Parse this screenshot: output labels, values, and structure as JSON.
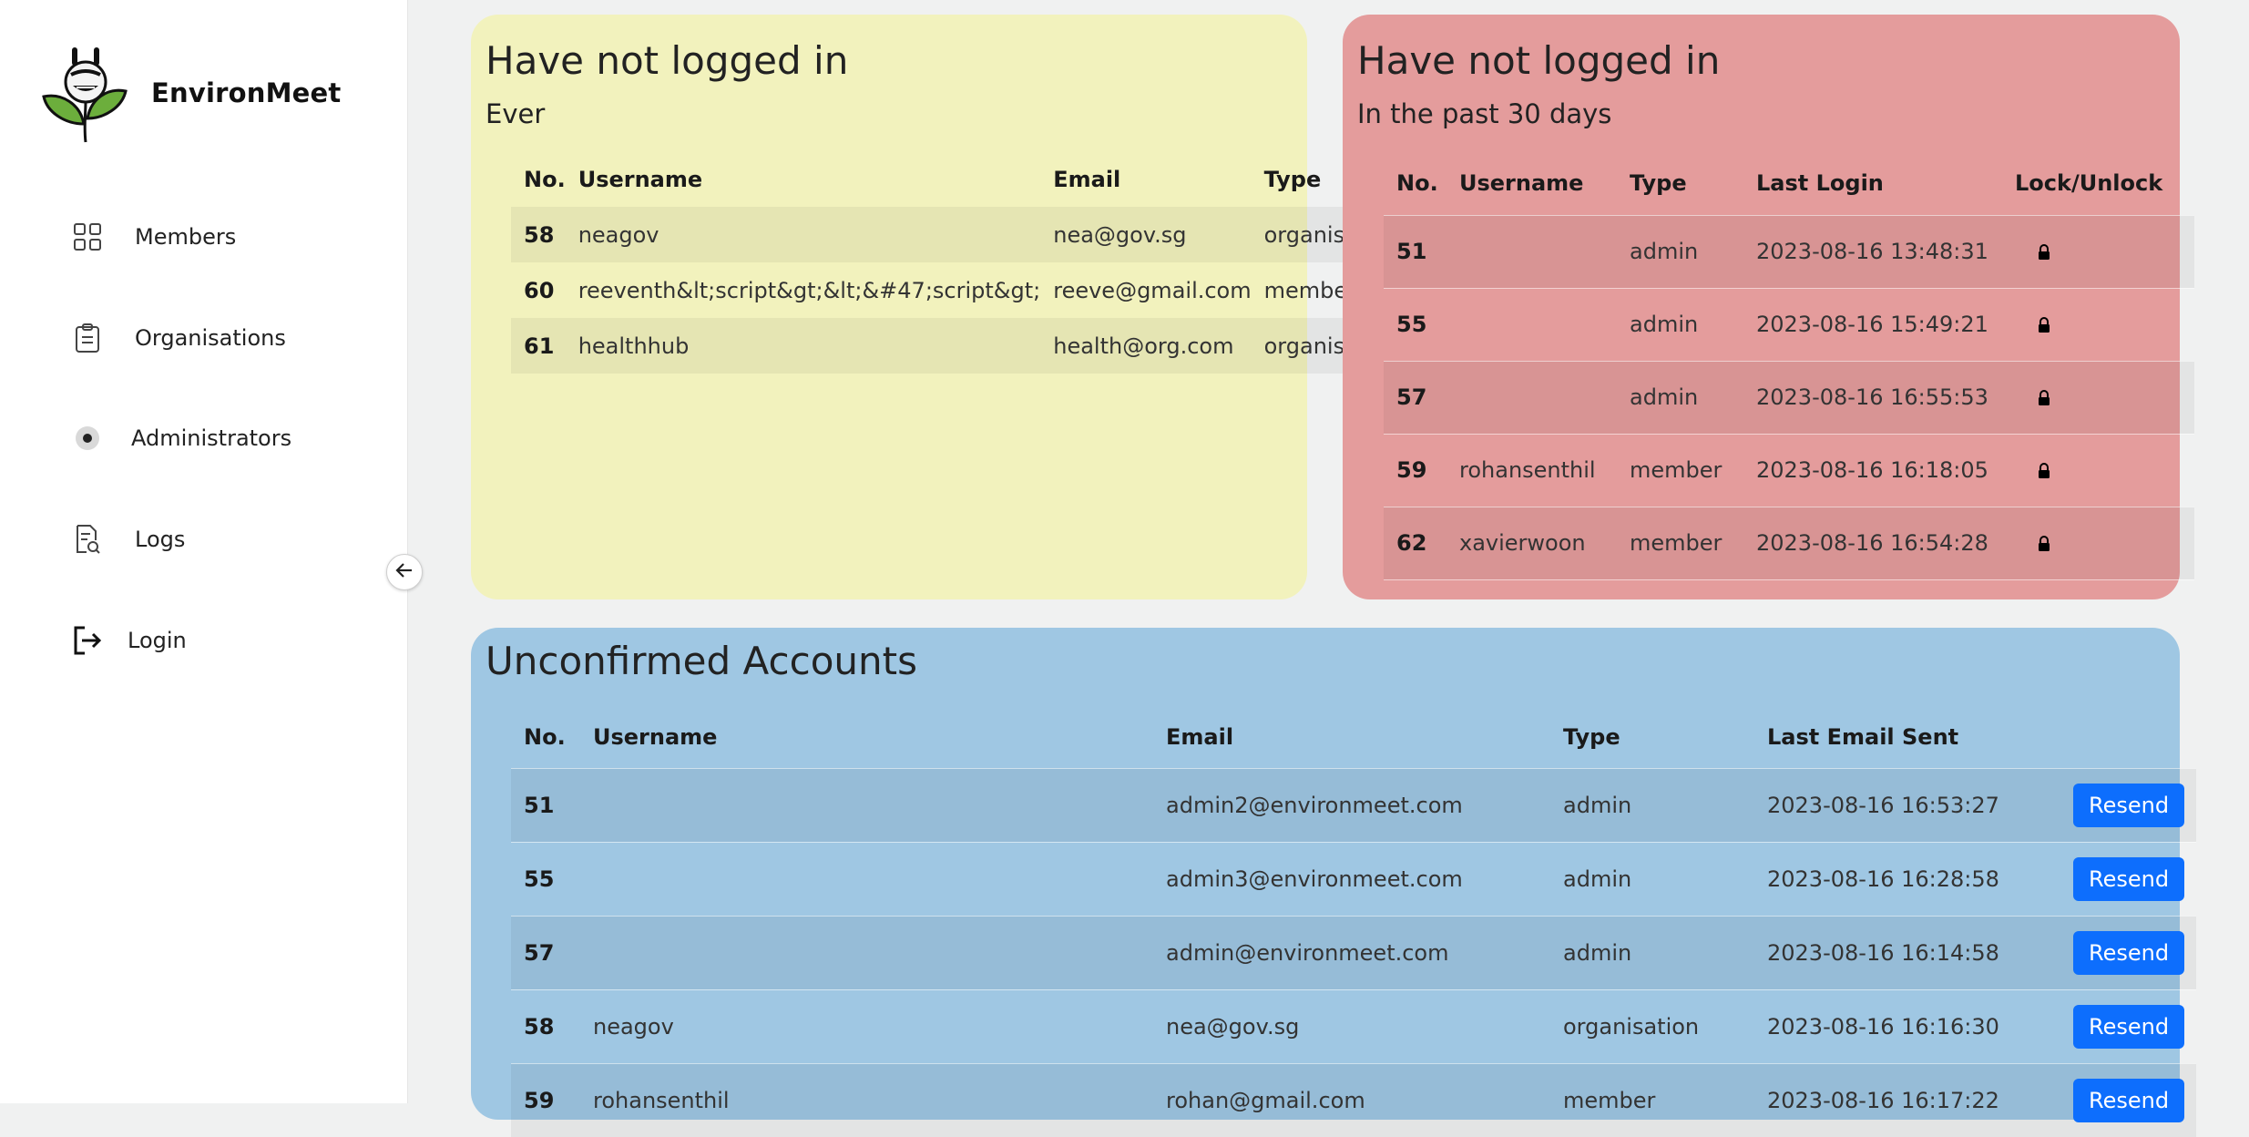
{
  "app": {
    "name": "EnvironMeet"
  },
  "sidebar": {
    "items": [
      {
        "label": "Members",
        "icon": "grid-icon"
      },
      {
        "label": "Organisations",
        "icon": "clipboard-icon"
      },
      {
        "label": "Administrators",
        "icon": "gear-icon"
      },
      {
        "label": "Logs",
        "icon": "document-search-icon"
      },
      {
        "label": "Login",
        "icon": "login-icon"
      }
    ],
    "collapse_icon": "arrow-left-icon"
  },
  "panel_never": {
    "title": "Have not logged in",
    "subtitle": "Ever",
    "color": "#f2f2bd",
    "columns": [
      "No.",
      "Username",
      "Email",
      "Type"
    ],
    "rows": [
      {
        "no": "58",
        "username": "neagov",
        "email": "nea@gov.sg",
        "type": "organisation"
      },
      {
        "no": "60",
        "username": "reeventh&lt;script&gt;&lt;&#47;script&gt;",
        "email": "reeve@gmail.com",
        "type": "member"
      },
      {
        "no": "61",
        "username": "healthhub",
        "email": "health@org.com",
        "type": "organisation"
      }
    ]
  },
  "panel_30days": {
    "title": "Have not logged in",
    "subtitle": "In the past 30 days",
    "color": "#e49c9c",
    "columns": [
      "No.",
      "Username",
      "Type",
      "Last Login",
      "Lock/Unlock"
    ],
    "rows": [
      {
        "no": "51",
        "username": "",
        "type": "admin",
        "last_login": "2023-08-16 13:48:31",
        "lock_icon": "lock-icon"
      },
      {
        "no": "55",
        "username": "",
        "type": "admin",
        "last_login": "2023-08-16 15:49:21",
        "lock_icon": "lock-icon"
      },
      {
        "no": "57",
        "username": "",
        "type": "admin",
        "last_login": "2023-08-16 16:55:53",
        "lock_icon": "lock-icon"
      },
      {
        "no": "59",
        "username": "rohansenthil",
        "type": "member",
        "last_login": "2023-08-16 16:18:05",
        "lock_icon": "lock-icon"
      },
      {
        "no": "62",
        "username": "xavierwoon",
        "type": "member",
        "last_login": "2023-08-16 16:54:28",
        "lock_icon": "lock-icon"
      }
    ]
  },
  "panel_unconfirmed": {
    "title": "Unconfirmed Accounts",
    "color": "#9fc7e3",
    "columns": [
      "No.",
      "Username",
      "Email",
      "Type",
      "Last Email Sent",
      ""
    ],
    "resend_label": "Resend",
    "resend_color": "#0d6efd",
    "rows": [
      {
        "no": "51",
        "username": "",
        "email": "admin2@environmeet.com",
        "type": "admin",
        "last_sent": "2023-08-16 16:53:27"
      },
      {
        "no": "55",
        "username": "",
        "email": "admin3@environmeet.com",
        "type": "admin",
        "last_sent": "2023-08-16 16:28:58"
      },
      {
        "no": "57",
        "username": "",
        "email": "admin@environmeet.com",
        "type": "admin",
        "last_sent": "2023-08-16 16:14:58"
      },
      {
        "no": "58",
        "username": "neagov",
        "email": "nea@gov.sg",
        "type": "organisation",
        "last_sent": "2023-08-16 16:16:30"
      },
      {
        "no": "59",
        "username": "rohansenthil",
        "email": "rohan@gmail.com",
        "type": "member",
        "last_sent": "2023-08-16 16:17:22"
      }
    ]
  }
}
